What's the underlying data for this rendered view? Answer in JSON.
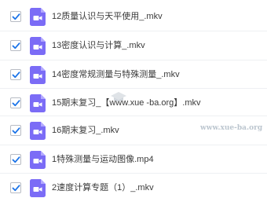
{
  "files": [
    {
      "name": "12质量认识与天平使用_.mkv",
      "checked": true,
      "icon": "video-file-icon"
    },
    {
      "name": "13密度认识与计算_.mkv",
      "checked": true,
      "icon": "video-file-icon"
    },
    {
      "name": "14密度常规测量与特殊测量_.mkv",
      "checked": true,
      "icon": "video-file-icon"
    },
    {
      "name": "15期末复习_【www.xue -ba.org】.mkv",
      "checked": true,
      "icon": "video-file-icon"
    },
    {
      "name": "16期末复习_.mkv",
      "checked": true,
      "icon": "video-file-icon"
    },
    {
      "name": "1特殊测量与运动图像.mp4",
      "checked": true,
      "icon": "video-file-icon"
    },
    {
      "name": "2速度计算专题（1）_.mkv",
      "checked": true,
      "icon": "video-file-icon"
    }
  ],
  "watermark": {
    "text": "www.xue-ba.org"
  },
  "colors": {
    "check": "#1a73e8",
    "icon_bg": "#7b6cf6",
    "text": "#3a3a3a"
  }
}
